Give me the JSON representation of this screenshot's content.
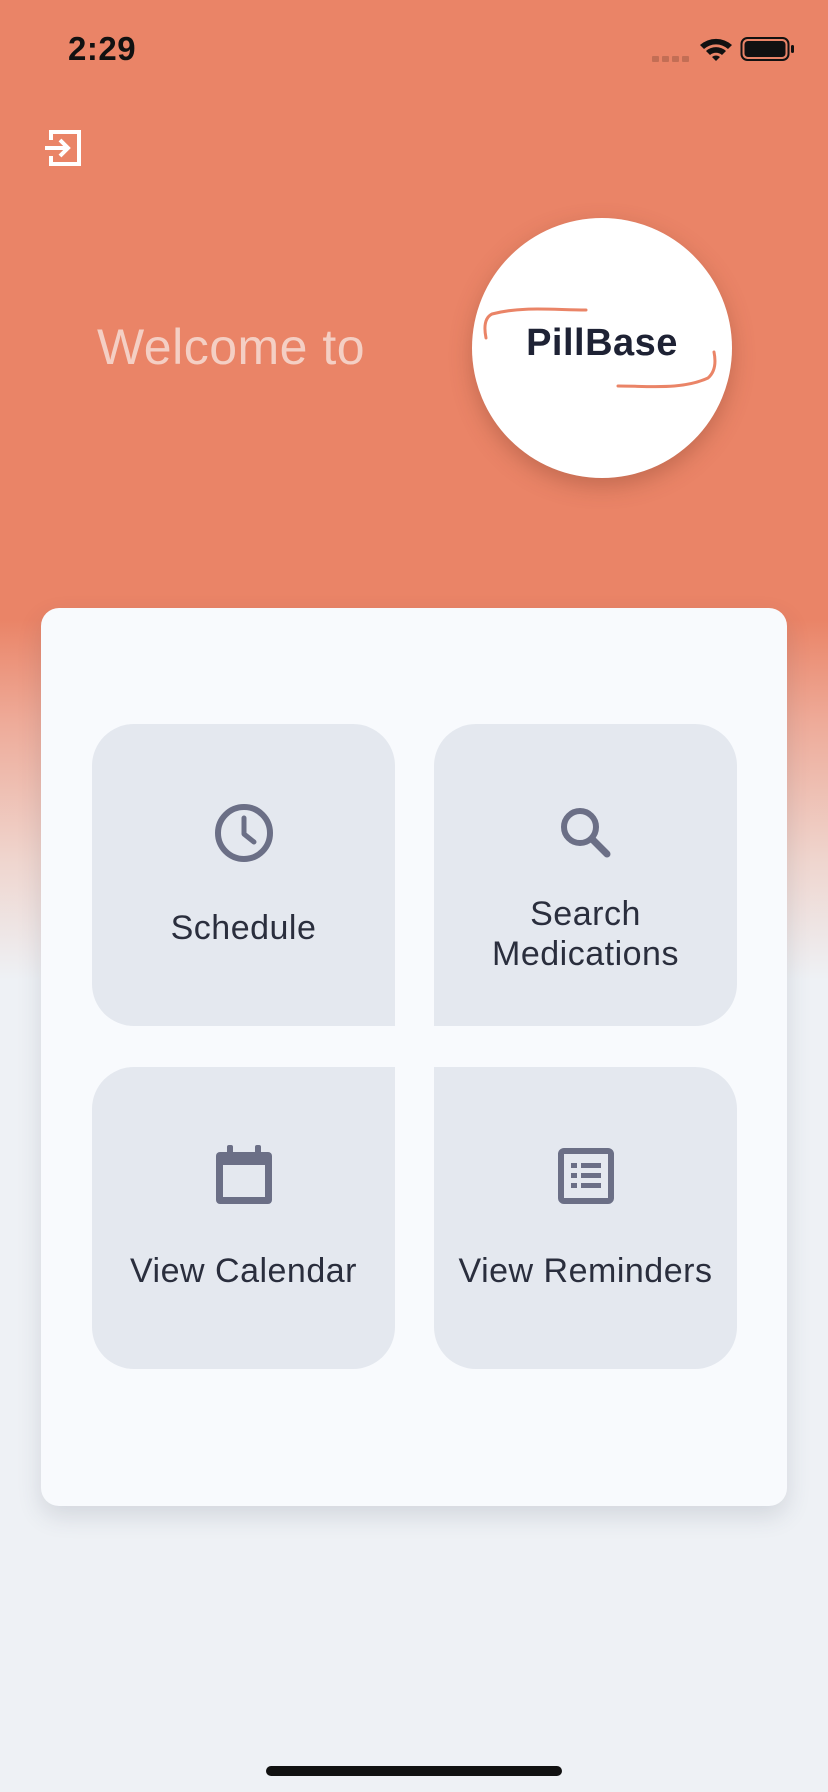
{
  "status_bar": {
    "time": "2:29",
    "icons": [
      "cellular-signal-icon",
      "wifi-icon",
      "battery-icon"
    ]
  },
  "header": {
    "logout_icon": "logout-icon",
    "welcome_text": "Welcome to",
    "logo_text": "PillBase"
  },
  "menu": {
    "tiles": [
      {
        "label": "Schedule",
        "icon": "clock-icon"
      },
      {
        "label": "Search\nMedications",
        "icon": "search-icon"
      },
      {
        "label": "View Calendar",
        "icon": "calendar-icon"
      },
      {
        "label": "View Reminders",
        "icon": "list-icon"
      }
    ]
  },
  "colors": {
    "header_background": "#ea8467",
    "page_background": "#eef1f5",
    "card_background": "#f8fafd",
    "tile_background": "#e4e8ef",
    "icon_color": "#6b6f86",
    "logo_accent": "#ea8467"
  }
}
